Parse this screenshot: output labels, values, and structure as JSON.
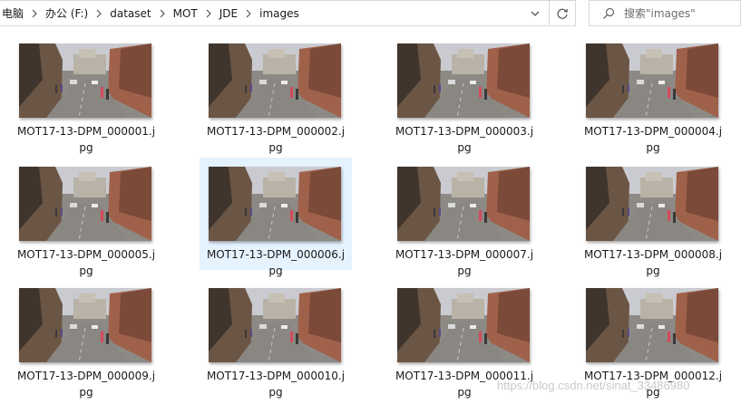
{
  "address_bar": {
    "breadcrumbs": [
      "电脑",
      "办公 (F:)",
      "dataset",
      "MOT",
      "JDE",
      "images"
    ]
  },
  "search": {
    "placeholder": "搜索\"images\""
  },
  "files": [
    {
      "name": "MOT17-13-DPM_000001.jpg",
      "line1": "MOT17-13-DPM_000001.j",
      "line2": "pg"
    },
    {
      "name": "MOT17-13-DPM_000002.jpg",
      "line1": "MOT17-13-DPM_000002.j",
      "line2": "pg"
    },
    {
      "name": "MOT17-13-DPM_000003.jpg",
      "line1": "MOT17-13-DPM_000003.j",
      "line2": "pg"
    },
    {
      "name": "MOT17-13-DPM_000004.jpg",
      "line1": "MOT17-13-DPM_000004.j",
      "line2": "pg"
    },
    {
      "name": "MOT17-13-DPM_000005.jpg",
      "line1": "MOT17-13-DPM_000005.j",
      "line2": "pg"
    },
    {
      "name": "MOT17-13-DPM_000006.jpg",
      "line1": "MOT17-13-DPM_000006.j",
      "line2": "pg",
      "selected": true
    },
    {
      "name": "MOT17-13-DPM_000007.jpg",
      "line1": "MOT17-13-DPM_000007.j",
      "line2": "pg"
    },
    {
      "name": "MOT17-13-DPM_000008.jpg",
      "line1": "MOT17-13-DPM_000008.j",
      "line2": "pg"
    },
    {
      "name": "MOT17-13-DPM_000009.jpg",
      "line1": "MOT17-13-DPM_000009.j",
      "line2": "pg"
    },
    {
      "name": "MOT17-13-DPM_000010.jpg",
      "line1": "MOT17-13-DPM_000010.j",
      "line2": "pg"
    },
    {
      "name": "MOT17-13-DPM_000011.jpg",
      "line1": "MOT17-13-DPM_000011.j",
      "line2": "pg"
    },
    {
      "name": "MOT17-13-DPM_000012.jpg",
      "line1": "MOT17-13-DPM_000012.j",
      "line2": "pg"
    }
  ],
  "watermark": "https://blog.csdn.net/sinat_33486980",
  "colors": {
    "selection": "#e5f3ff",
    "border": "#d9d9d9"
  },
  "icons": {
    "refresh": "refresh-icon",
    "search": "search-icon",
    "dropdown": "chevron-down-icon",
    "separator": "chevron-right-icon"
  }
}
